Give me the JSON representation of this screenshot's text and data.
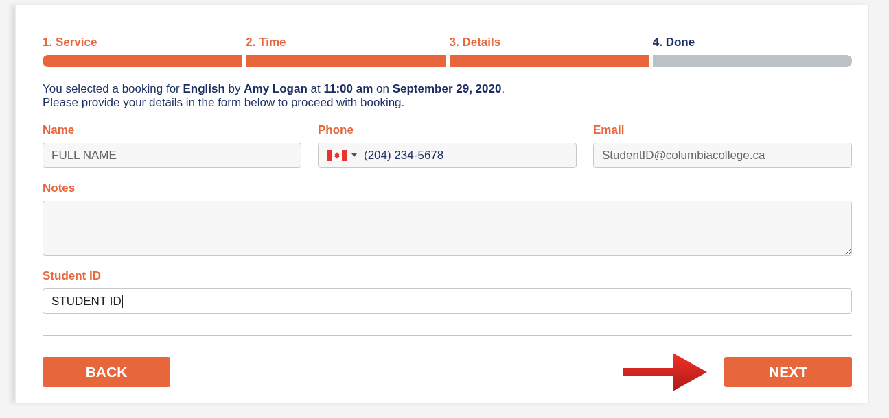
{
  "steps": [
    {
      "label": "1. Service",
      "completed": true
    },
    {
      "label": "2. Time",
      "completed": true
    },
    {
      "label": "3. Details",
      "completed": true
    },
    {
      "label": "4. Done",
      "completed": false
    }
  ],
  "summary": [
    "You selected a booking for **English** by **Amy Logan** at **11:00 am** on **September 29, 2020**.",
    "Please provide your details in the form below to proceed with booking."
  ],
  "fields": [
    {
      "kind": "text",
      "label": "Name",
      "placeholder": "FULL NAME"
    },
    {
      "kind": "phone",
      "label": "Phone",
      "value": "(204) 234-5678"
    },
    {
      "kind": "text",
      "label": "Email",
      "placeholder": "StudentID@columbiacollege.ca"
    }
  ],
  "notes": {
    "label": "Notes"
  },
  "student_id": {
    "label": "Student ID",
    "value": "STUDENT ID",
    "focused": true
  },
  "buttons": [
    {
      "label": "BACK"
    },
    {
      "label": "NEXT",
      "pointed": true
    }
  ]
}
